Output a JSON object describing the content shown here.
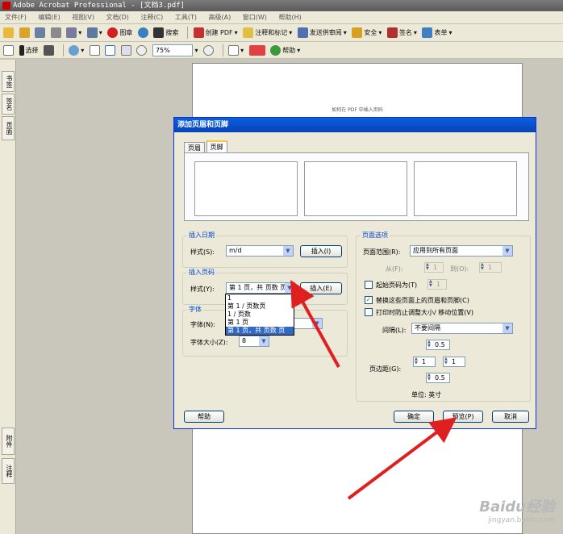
{
  "window": {
    "title": "Adobe Acrobat Professional - [文档3.pdf]"
  },
  "menu": [
    "文件(F)",
    "编辑(E)",
    "视图(V)",
    "文档(D)",
    "注释(C)",
    "工具(T)",
    "高级(A)",
    "窗口(W)",
    "帮助(H)"
  ],
  "toolbar1": {
    "tuzhang": "图章",
    "search": "搜索",
    "create_pdf": "创建 PDF",
    "annotate": "注释和标记",
    "send_review": "发送供审阅",
    "security": "安全",
    "sign": "签名",
    "forms": "表单"
  },
  "toolbar2": {
    "select": "选择",
    "zoom_value": "75%",
    "help": "帮助"
  },
  "left_tabs": {
    "bookmarks": "书签",
    "signatures": "签名",
    "pages": "页面",
    "attachments": "附件",
    "comments": "注释"
  },
  "document": {
    "text": "如何在 PDF 中插入页码"
  },
  "dialog": {
    "title": "添加页眉和页脚",
    "tabs": [
      "页眉",
      "页脚"
    ],
    "insert_date": {
      "label": "插入日期",
      "style_label": "样式(S):",
      "style_value": "m/d",
      "insert_button": "插入(I)"
    },
    "insert_page": {
      "label": "插入页码",
      "style_label": "样式(Y):",
      "style_value": "第 1 页，共 页数 页",
      "insert_button": "插入(E)"
    },
    "font": {
      "label": "字体",
      "name_label": "字体(N):",
      "size_label": "字体大小(Z):",
      "size_value": "8"
    },
    "page_options": {
      "label": "页面选项",
      "range_label": "页面范围(R):",
      "range_value": "应用到所有页面",
      "from_label": "从(F):",
      "from_value": "1",
      "to_label": "到(O):",
      "to_value": "1",
      "start_page_label": "起始页码为(T)",
      "start_page_value": "1",
      "replace_label": "替换这些页面上的页眉和页脚(C)",
      "shrink_label": "打印时防止调整大小/ 移动位置(V)",
      "spacing_label": "间隔(L):",
      "spacing_value": "不要间隔",
      "margin_label": "页边距(G):",
      "margin_top": "0.5",
      "margin_left": "1",
      "margin_right": "1",
      "margin_bottom": "0.5",
      "unit_label": "单位: 英寸"
    },
    "buttons": {
      "help": "帮助",
      "ok": "确定",
      "preview": "预览(P)",
      "cancel": "取消"
    },
    "dropdown_options": [
      "1",
      "第 1 / 页数页",
      "1 / 页数",
      "第 1 页",
      "第 1 页，共 页数 页"
    ],
    "dropdown_selected": "第 1 页，共 页数 页"
  },
  "watermark": {
    "brand": "Baidu经验",
    "url": "jingyan.baidu.com"
  },
  "colors": {
    "annotation_arrow": "#e02020",
    "dialog_title": "#0a5fe0",
    "selection": "#316ac5"
  }
}
